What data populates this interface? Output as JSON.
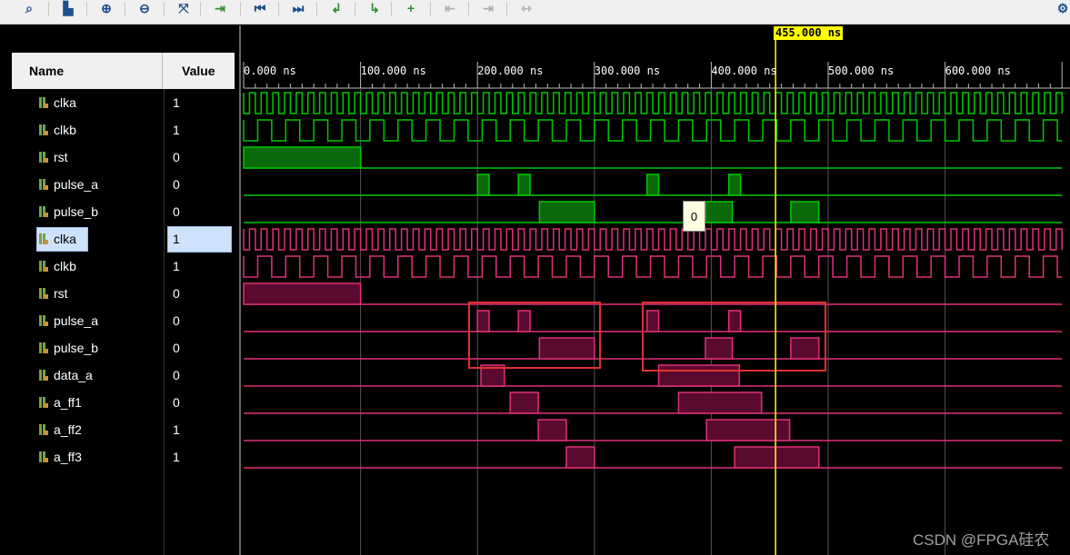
{
  "toolbar": {
    "buttons": [
      {
        "name": "search-icon",
        "glyph": "⌕"
      },
      {
        "name": "save-icon",
        "glyph": "▙"
      },
      {
        "name": "zoom-in-icon",
        "glyph": "⊕"
      },
      {
        "name": "zoom-out-icon",
        "glyph": "⊖"
      },
      {
        "name": "zoom-fit-icon",
        "glyph": "⤧"
      },
      {
        "name": "go-to-cursor-icon",
        "glyph": "⇥"
      },
      {
        "name": "go-to-start-icon",
        "glyph": "⏮"
      },
      {
        "name": "go-to-end-icon",
        "glyph": "⏭"
      },
      {
        "name": "previous-transition-icon",
        "glyph": "↲"
      },
      {
        "name": "next-transition-icon",
        "glyph": "↳"
      },
      {
        "name": "add-marker-icon",
        "glyph": "+"
      },
      {
        "name": "previous-marker-icon",
        "glyph": "⇤"
      },
      {
        "name": "next-marker-icon",
        "glyph": "⇥"
      },
      {
        "name": "swap-cursors-icon",
        "glyph": "⇿"
      },
      {
        "name": "settings-gear-icon",
        "glyph": "⚙"
      }
    ]
  },
  "columns": {
    "name": "Name",
    "value": "Value"
  },
  "signals": [
    {
      "name": "clka",
      "value": "1",
      "group": "green"
    },
    {
      "name": "clkb",
      "value": "1",
      "group": "green"
    },
    {
      "name": "rst",
      "value": "0",
      "group": "green"
    },
    {
      "name": "pulse_a",
      "value": "0",
      "group": "green"
    },
    {
      "name": "pulse_b",
      "value": "0",
      "group": "green"
    },
    {
      "name": "clka",
      "value": "1",
      "group": "pink"
    },
    {
      "name": "clkb",
      "value": "1",
      "group": "pink"
    },
    {
      "name": "rst",
      "value": "0",
      "group": "pink"
    },
    {
      "name": "pulse_a",
      "value": "0",
      "group": "pink"
    },
    {
      "name": "pulse_b",
      "value": "0",
      "group": "pink"
    },
    {
      "name": "data_a",
      "value": "0",
      "group": "pink"
    },
    {
      "name": "a_ff1",
      "value": "0",
      "group": "pink"
    },
    {
      "name": "a_ff2",
      "value": "1",
      "group": "pink"
    },
    {
      "name": "a_ff3",
      "value": "1",
      "group": "pink"
    }
  ],
  "timeline": {
    "labels": [
      "0.000 ns",
      "100.000 ns",
      "200.000 ns",
      "300.000 ns",
      "400.000 ns",
      "500.000 ns",
      "600.000 ns"
    ],
    "cursor_label": "455.000 ns"
  },
  "tooltip": "0",
  "watermark": "CSDN @FPGA硅农",
  "colors": {
    "green": "#00c800",
    "green_fill": "#0a6a0a",
    "pink": "#e0307a",
    "pink_fill": "#5a0a2e",
    "cursor": "#ffff00",
    "highlight_box": "#e03030"
  }
}
